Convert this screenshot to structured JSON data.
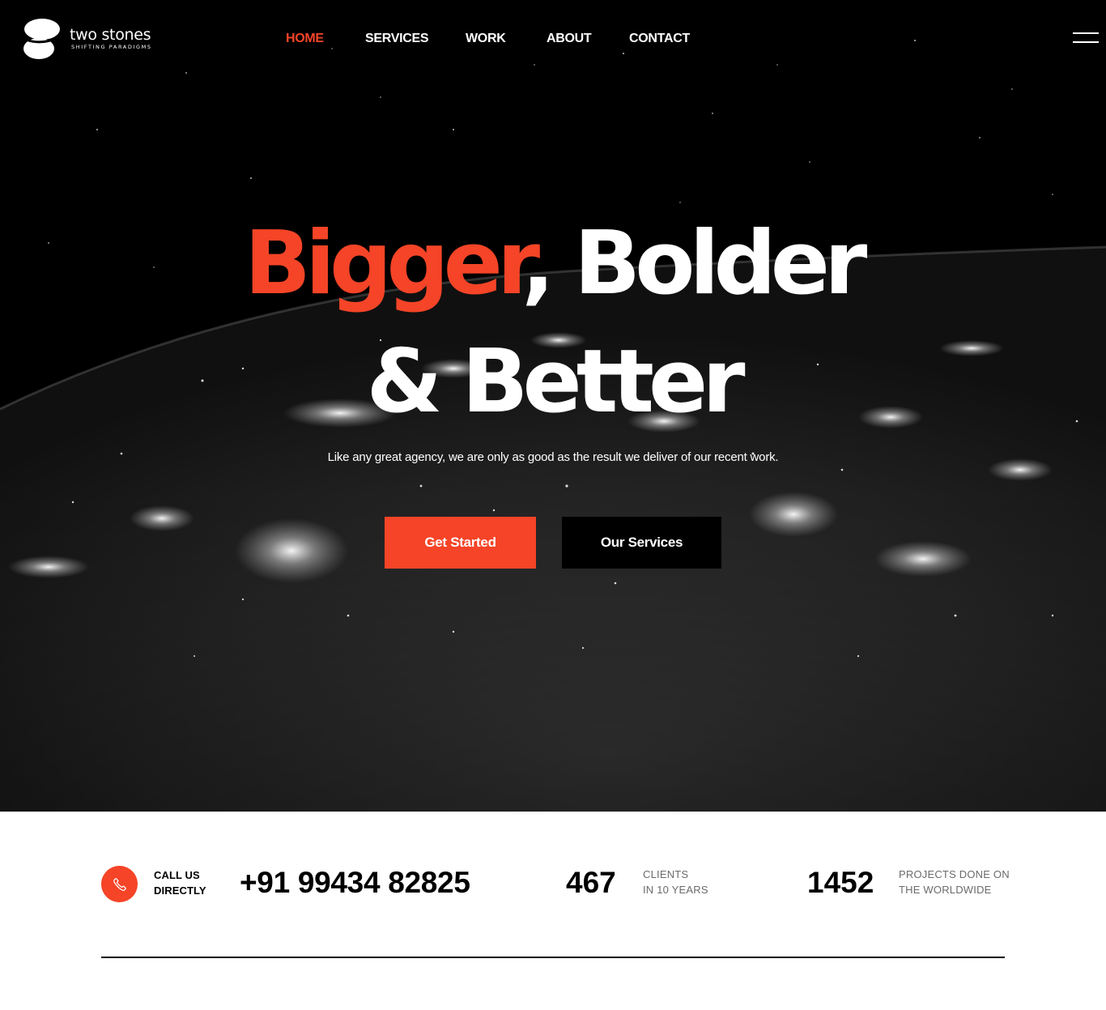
{
  "brand": {
    "name": "two stones",
    "tagline": "SHIFTING PARADIGMS"
  },
  "nav": {
    "items": [
      {
        "label": "HOME",
        "active": true
      },
      {
        "label": "SERVICES",
        "active": false
      },
      {
        "label": "WORK",
        "active": false
      },
      {
        "label": "ABOUT",
        "active": false
      },
      {
        "label": "CONTACT",
        "active": false
      }
    ],
    "menu_icon": "hamburger-icon"
  },
  "hero": {
    "headline_accent": "Bigger",
    "headline_rest_line1": ", Bolder",
    "headline_line2": "& Better",
    "subtitle": "Like any great agency, we are only as good as the result we deliver of our recent work.",
    "primary_button": "Get Started",
    "secondary_button": "Our Services",
    "background": "night-earth-from-space"
  },
  "contact": {
    "icon": "phone-icon",
    "label_line1": "CALL US",
    "label_line2": "DIRECTLY",
    "phone": "+91 99434 82825"
  },
  "stats": [
    {
      "value": "467",
      "label_line1": "CLIENTS",
      "label_line2": "IN 10 YEARS"
    },
    {
      "value": "1452",
      "label_line1": "PROJECTS DONE ON",
      "label_line2": "THE WORLDWIDE"
    }
  ],
  "colors": {
    "accent": "#f54427",
    "dark": "#000000",
    "text_muted": "#6b6b6b"
  }
}
